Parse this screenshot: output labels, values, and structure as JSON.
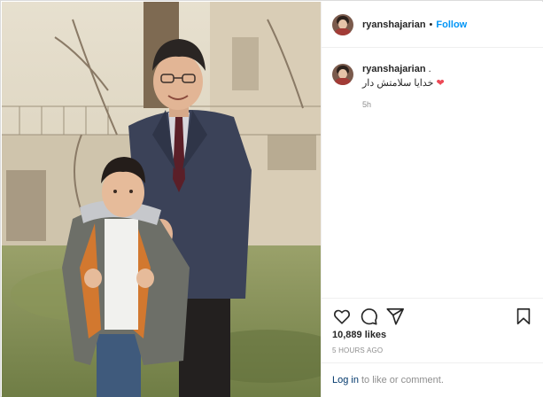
{
  "post": {
    "username": "ryanshajarian",
    "separator": "•",
    "follow_label": "Follow"
  },
  "caption": {
    "username": "ryanshajarian",
    "suffix": " .",
    "text": "خدایا سلامتش دار",
    "heart": "❤",
    "time": "5h"
  },
  "actions": {
    "like_icon": "heart-outline-icon",
    "comment_icon": "comment-icon",
    "share_icon": "paper-plane-icon",
    "save_icon": "bookmark-icon"
  },
  "stats": {
    "likes": "10,889 likes",
    "time_ago": "5 HOURS AGO"
  },
  "login": {
    "link": "Log in",
    "text": "to like or comment."
  },
  "colors": {
    "follow": "#0095f6",
    "heart": "#ed4956",
    "link": "#00376b",
    "muted": "#8e8e8e",
    "border": "#dbdbdb"
  }
}
